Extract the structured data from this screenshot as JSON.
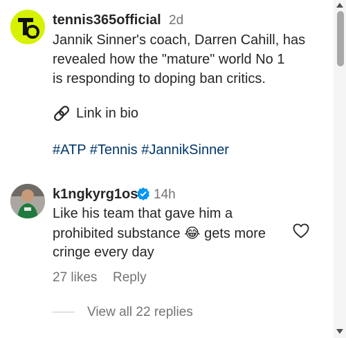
{
  "post": {
    "author": "tennis365official",
    "time": "2d",
    "lines": [
      "Jannik Sinner's coach, Darren Cahill, has",
      "revealed how the \"mature\" world No 1",
      "is responding to doping ban critics."
    ],
    "link_in_bio": "Link in bio",
    "hashtags": "#ATP #Tennis #JannikSinner"
  },
  "comment": {
    "author": "k1ngkyrg1os",
    "time": "14h",
    "lines": [
      "Like his team that gave him a",
      "prohibited substance",
      "gets more",
      "cringe every day"
    ],
    "emoji": "😂",
    "likes": "27 likes",
    "reply_label": "Reply",
    "view_replies": "View all 22 replies"
  },
  "colors": {
    "text": "#262626",
    "muted": "#737373",
    "hashtag": "#00376b",
    "verified": "#0095f6",
    "logo_bg": "#d6f200"
  },
  "icons": [
    "tennis365-logo",
    "link-icon",
    "verified-badge-icon",
    "heart-icon",
    "scroll-up-icon",
    "scroll-down-icon"
  ]
}
